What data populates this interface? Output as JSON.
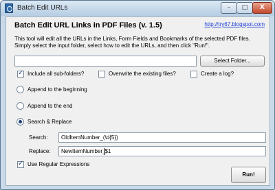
{
  "window": {
    "title": "Batch Edit URLs",
    "minimize_label": "–",
    "maximize_label": "□",
    "close_label": "X"
  },
  "header": {
    "heading": "Batch Edit URL Links in PDF Files (v. 1.5)",
    "link": "http://try67.blogspot.com"
  },
  "description": {
    "line1": "This tool will edit all the URLs in the Links, Form Fields and Bookmarks of the selected PDF files.",
    "line2": "Simply select the input folder, select how to edit the URLs, and then click \"Run!\"."
  },
  "folder": {
    "value": "",
    "select_button": "Select Folder..."
  },
  "options": {
    "include_subfolders": {
      "label": "Include all sub-folders?",
      "checked": true
    },
    "overwrite_existing": {
      "label": "Overwrite the existing files?",
      "checked": false
    },
    "create_log": {
      "label": "Create a log?",
      "checked": false
    }
  },
  "modes": {
    "append_beginning": {
      "label": "Append to the beginning",
      "selected": false
    },
    "append_end": {
      "label": "Append to the end",
      "selected": false
    },
    "search_replace": {
      "label": "Search & Replace",
      "selected": true
    }
  },
  "search": {
    "label": "Search:",
    "value": "OldItemNumber_(\\d{5})"
  },
  "replace": {
    "label": "Replace:",
    "value_before_caret": "NewItemNumber_",
    "value_after_caret": "$1"
  },
  "regex": {
    "label": "Use Regular Expressions",
    "checked": true
  },
  "run_button": "Run!"
}
